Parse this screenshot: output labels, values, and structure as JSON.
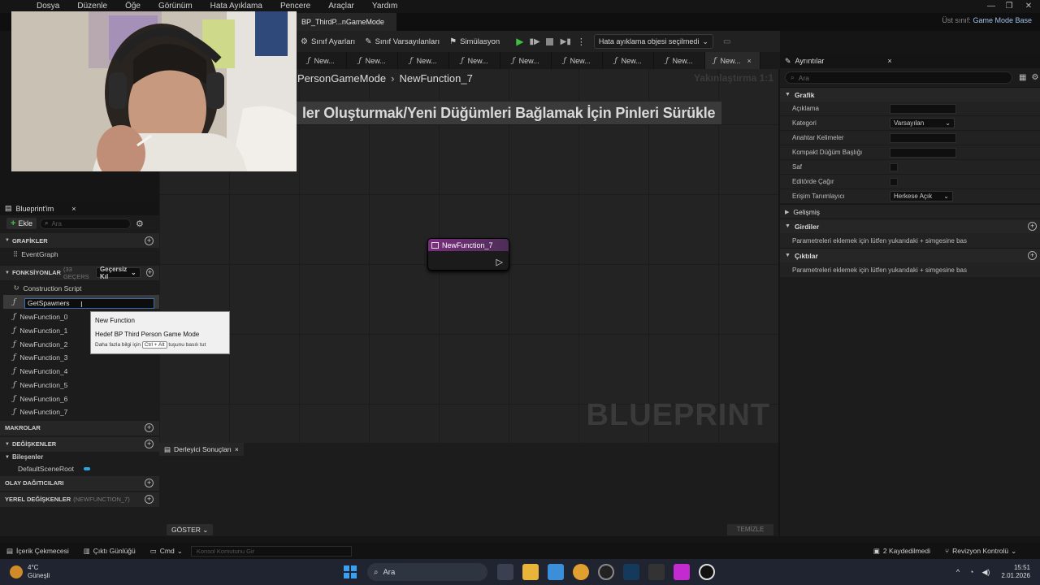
{
  "app_logo": "U",
  "menu": [
    "Dosya",
    "Düzenle",
    "Öğe",
    "Görünüm",
    "Hata Ayıklama",
    "Pencere",
    "Araçlar",
    "Yardım"
  ],
  "doc_tab": {
    "label": "BP_ThirdP...nGameMode •",
    "close": "×"
  },
  "parent_class": {
    "label": "Üst sınıf:",
    "value": "Game Mode Base"
  },
  "window_controls": [
    "—",
    "❐",
    "✕"
  ],
  "toolbar": {
    "class_settings": "Sınıf Ayarları",
    "class_defaults": "Sınıf Varsayılanları",
    "simulation": "Simülasyon",
    "debug_object": "Hata ayıklama objesi seçilmedi"
  },
  "function_tabs": [
    "New...",
    "New...",
    "New...",
    "New...",
    "New...",
    "New...",
    "New...",
    "New...",
    "New..."
  ],
  "breadcrumb": {
    "parent": "PersonGameMode",
    "current": "NewFunction_7",
    "sep": "›"
  },
  "zoom": "Yakınlaştırma 1:1",
  "graph_hint": "ler Oluşturmak/Yeni Düğümleri Bağlamak İçin Pinleri Sürükle",
  "watermark": "BLUEPRINT",
  "node": {
    "title": "NewFunction_7"
  },
  "details": {
    "title": "Ayrıntılar",
    "search_placeholder": "Ara",
    "sections": {
      "graph": "Grafik",
      "advanced": "Gelişmiş",
      "inputs": "Girdiler",
      "outputs": "Çıktılar"
    },
    "rows": {
      "description": "Açıklama",
      "category": "Kategori",
      "category_value": "Varsayılan",
      "keywords": "Anahtar Kelimeler",
      "compact_title": "Kompakt Düğüm Başlığı",
      "pure": "Saf",
      "call_in_editor": "Editörde Çağır",
      "access": "Erişim Tanımlayıcı",
      "access_value": "Herkese Açık"
    },
    "inputs_note": "Parametreleri eklemek için lütfen yukarıdaki + simgesine bas",
    "outputs_note": "Parametreleri eklemek için lütfen yukarıdaki + simgesine bas"
  },
  "my_blueprint": {
    "title": "Blueprint'im",
    "add": "Ekle",
    "search_placeholder": "Ara",
    "graphs": "GRAFİKLER",
    "event_graph": "EventGraph",
    "functions": "FONKSİYONLAR",
    "functions_sub": "(33 GEÇERS",
    "override": "Geçersiz Kıl",
    "construction_script": "Construction Script",
    "rename_value": "GetSpawners",
    "function_items": [
      "NewFunction_0",
      "NewFunction_1",
      "NewFunction_2",
      "NewFunction_3",
      "NewFunction_4",
      "NewFunction_5",
      "NewFunction_6",
      "NewFunction_7"
    ],
    "macros": "MAKROLAR",
    "variables": "DEĞİŞKENLER",
    "components": "Bileşenler",
    "default_scene_root": "DefaultSceneRoot",
    "event_dispatchers": "OLAY DAĞITICILARI",
    "local_variables": "YEREL DEĞİŞKENLER",
    "local_variables_sub": "(NEWFUNCTION_7)"
  },
  "tooltip": {
    "line1": "New Function",
    "line2": "Hedef BP Third Person Game Mode",
    "line3_pre": "Daha fazla bilgi için",
    "line3_key": "Ctrl + Alt",
    "line3_post": "tuşunu basılı tut"
  },
  "compiler": {
    "tab": "Derleyici Sonuçları",
    "show": "GÖSTER",
    "clear": "TEMİZLE"
  },
  "statusbar": {
    "content_drawer": "İçerik Çekmecesi",
    "output_log": "Çıktı Günlüğü",
    "cmd": "Cmd",
    "console_placeholder": "Konsol Komutunu Gir",
    "unsaved": "2 Kaydedilmedi",
    "revision": "Revizyon Kontrolü"
  },
  "taskbar": {
    "weather_temp": "4°C",
    "weather_desc": "Güneşli",
    "search": "Ara",
    "time": "15:51",
    "date": "2.01.2026"
  },
  "colors": {
    "accent": "#3a6aa8",
    "node_header": "#7b2d7e",
    "play": "#3fbf3f"
  }
}
